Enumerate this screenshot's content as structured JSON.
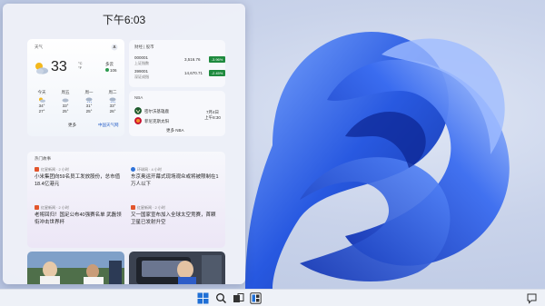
{
  "panel": {
    "clock": "下午6:03"
  },
  "weather": {
    "title": "天气",
    "temp": "33",
    "unit_c": "°C",
    "unit_f": "°F",
    "condition": "多云",
    "aqi": "106",
    "forecast": [
      {
        "day": "今天",
        "hi": "34°",
        "lo": "27°"
      },
      {
        "day": "周五",
        "hi": "33°",
        "lo": "25°"
      },
      {
        "day": "周一",
        "hi": "31°",
        "lo": "25°"
      },
      {
        "day": "周二",
        "hi": "33°",
        "lo": "26°"
      }
    ],
    "more_label": "更多",
    "link_label": "中国天气网"
  },
  "stocks": {
    "title": "财经 | 股市",
    "rows": [
      {
        "code": "000001",
        "name": "上证指数",
        "value": "3,516.76",
        "change": "-3.96%"
      },
      {
        "code": "399001",
        "name": "深证成指",
        "value": "14,670.71",
        "change": "-2.45%"
      }
    ]
  },
  "nba": {
    "title": "NBA",
    "team1": "密尔沃基雄鹿",
    "team2": "菲尼克斯太阳",
    "date": "7月4日",
    "time": "上午8:30",
    "more_label": "更多 NBA"
  },
  "stories": {
    "title": "热门故事",
    "items": [
      {
        "source": "红星新闻 · 2 小时",
        "headline": "小米集团向59名员工发放股份，总市值18.4亿港元"
      },
      {
        "source": "环球网 · 4 小时",
        "headline": "东京奥运开幕式现场观众或将被限制在1万人以下"
      },
      {
        "source": "红星新闻 · 2 小时",
        "headline": "老将回归！国足公布40强赛名单 武磊领衔冲击世界杯"
      },
      {
        "source": "红星新闻 · 2 小时",
        "headline": "又一国家宣布加入全球太空竞赛，首颗卫星已发射升空"
      }
    ]
  },
  "colors": {
    "accent": "#1f6fd6",
    "stock_down": "#1e8a3e",
    "wallpaper_blue": "#1447c9"
  }
}
